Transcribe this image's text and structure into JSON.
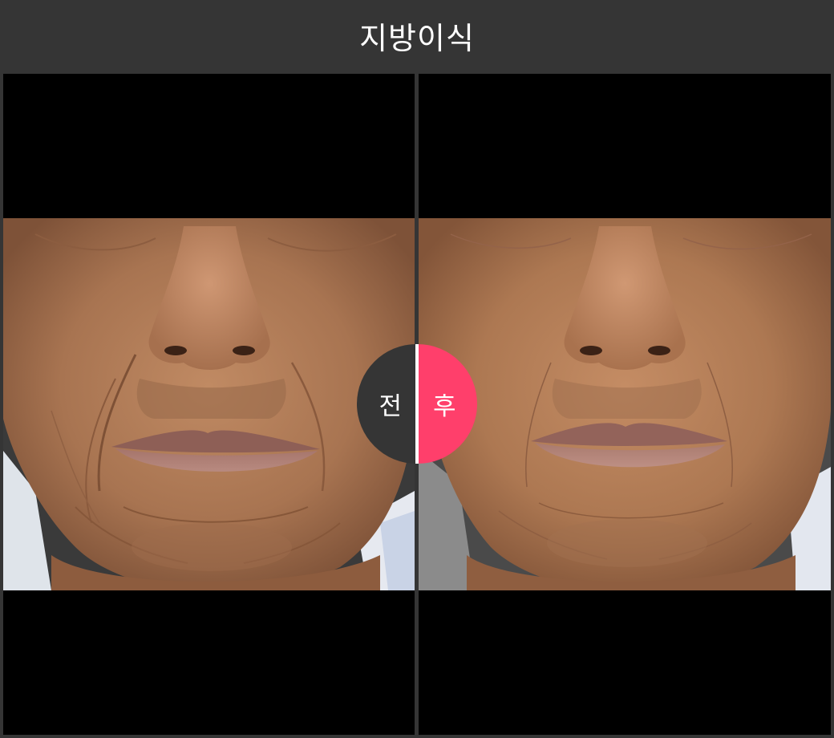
{
  "header": {
    "title": "지방이식"
  },
  "comparison": {
    "before_label": "전",
    "after_label": "후",
    "before_image_icon": "face-before-photo",
    "after_image_icon": "face-after-photo"
  },
  "colors": {
    "background": "#353535",
    "photo_backdrop": "#000000",
    "before_badge": "#353535",
    "after_badge": "#ff3f6b",
    "skin": "#b07a55"
  }
}
